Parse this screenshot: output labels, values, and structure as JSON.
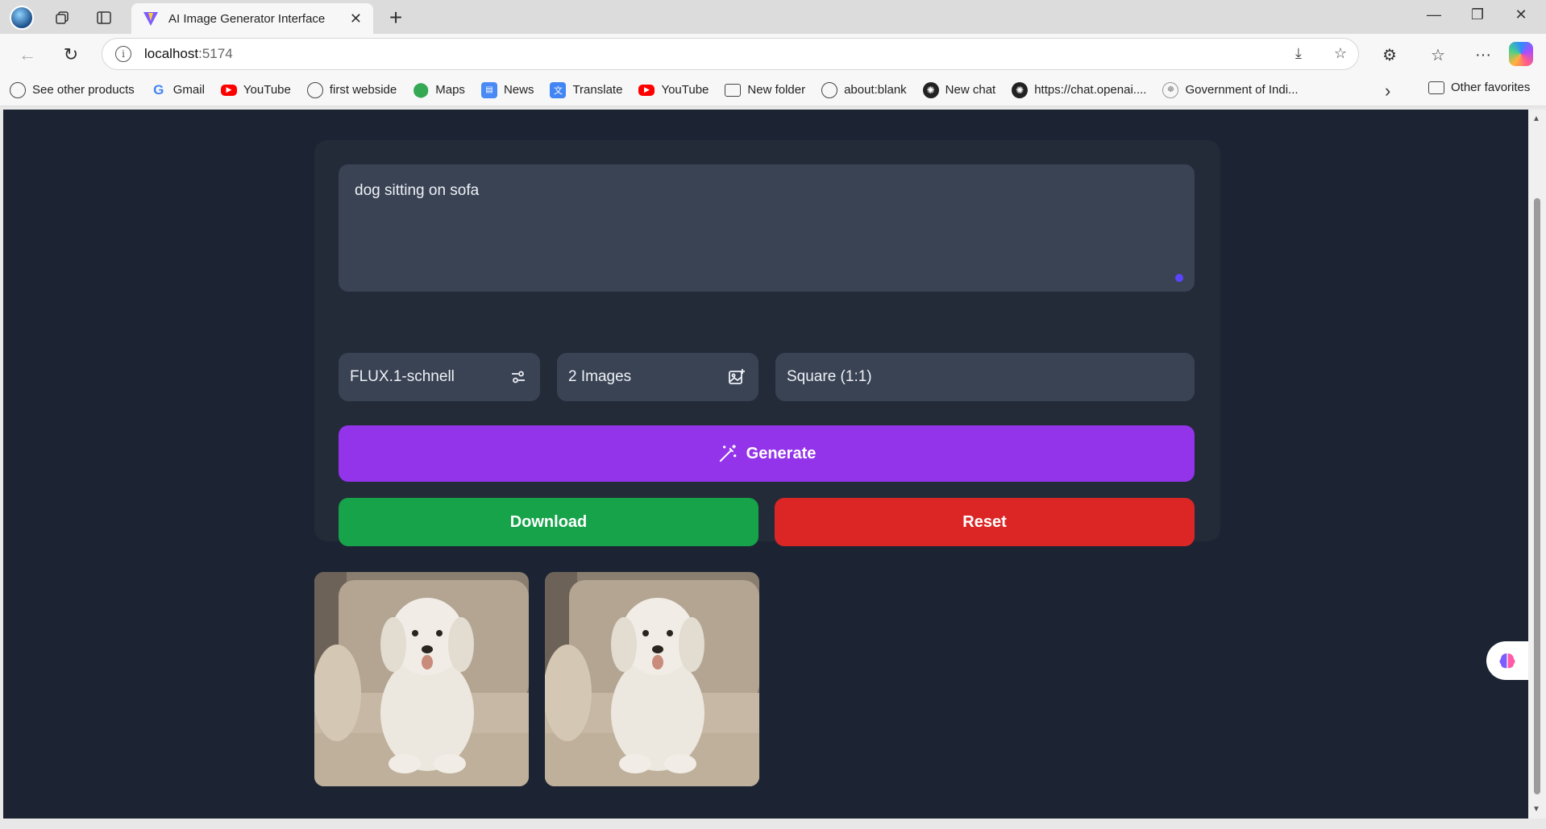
{
  "browser": {
    "tab_title": "AI Image Generator Interface",
    "url_host": "localhost",
    "url_port": ":5174"
  },
  "bookmarks": [
    {
      "label": "See other products",
      "icon": "globe-icon"
    },
    {
      "label": "Gmail",
      "icon": "google-icon"
    },
    {
      "label": "YouTube",
      "icon": "youtube-icon"
    },
    {
      "label": "first webside",
      "icon": "globe-icon"
    },
    {
      "label": "Maps",
      "icon": "maps-icon"
    },
    {
      "label": "News",
      "icon": "news-icon"
    },
    {
      "label": "Translate",
      "icon": "translate-icon"
    },
    {
      "label": "YouTube",
      "icon": "youtube-icon"
    },
    {
      "label": "New folder",
      "icon": "folder-icon"
    },
    {
      "label": "about:blank",
      "icon": "globe-icon"
    },
    {
      "label": "New chat",
      "icon": "chatgpt-icon"
    },
    {
      "label": "https://chat.openai....",
      "icon": "chatgpt-icon"
    },
    {
      "label": "Government of Indi...",
      "icon": "emblem-icon"
    }
  ],
  "other_favorites": "Other favorites",
  "generator": {
    "prompt": "dog sitting on sofa",
    "model": "FLUX.1-schnell",
    "image_count": "2 Images",
    "aspect_ratio": "Square (1:1)",
    "generate_label": "Generate",
    "download_label": "Download",
    "reset_label": "Reset"
  },
  "images": [
    {
      "alt": "dog sitting on sofa"
    },
    {
      "alt": "dog sitting on sofa"
    }
  ],
  "colors": {
    "page_bg": "#1c2433",
    "card_bg": "#232b39",
    "field_bg": "#3a4354",
    "generate": "#9333ea",
    "download": "#16a34a",
    "reset": "#dc2626"
  }
}
